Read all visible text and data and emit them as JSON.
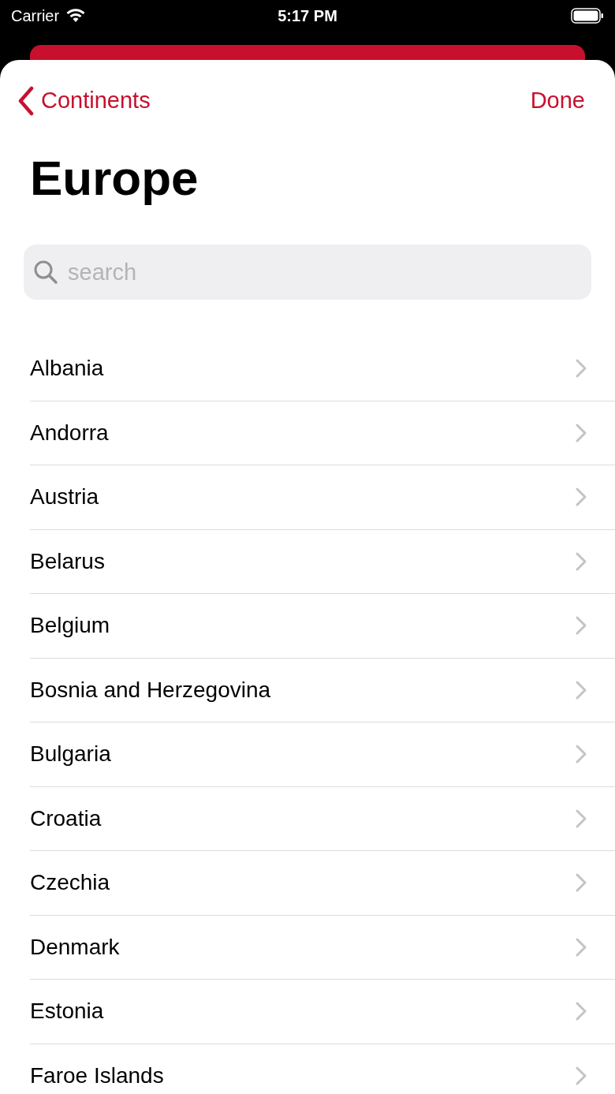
{
  "status_bar": {
    "carrier": "Carrier",
    "time": "5:17 PM"
  },
  "nav": {
    "back": "Continents",
    "done": "Done"
  },
  "title": "Europe",
  "search": {
    "placeholder": "search"
  },
  "countries": [
    {
      "name": "Albania"
    },
    {
      "name": "Andorra"
    },
    {
      "name": "Austria"
    },
    {
      "name": "Belarus"
    },
    {
      "name": "Belgium"
    },
    {
      "name": "Bosnia and Herzegovina"
    },
    {
      "name": "Bulgaria"
    },
    {
      "name": "Croatia"
    },
    {
      "name": "Czechia"
    },
    {
      "name": "Denmark"
    },
    {
      "name": "Estonia"
    },
    {
      "name": "Faroe Islands"
    }
  ]
}
